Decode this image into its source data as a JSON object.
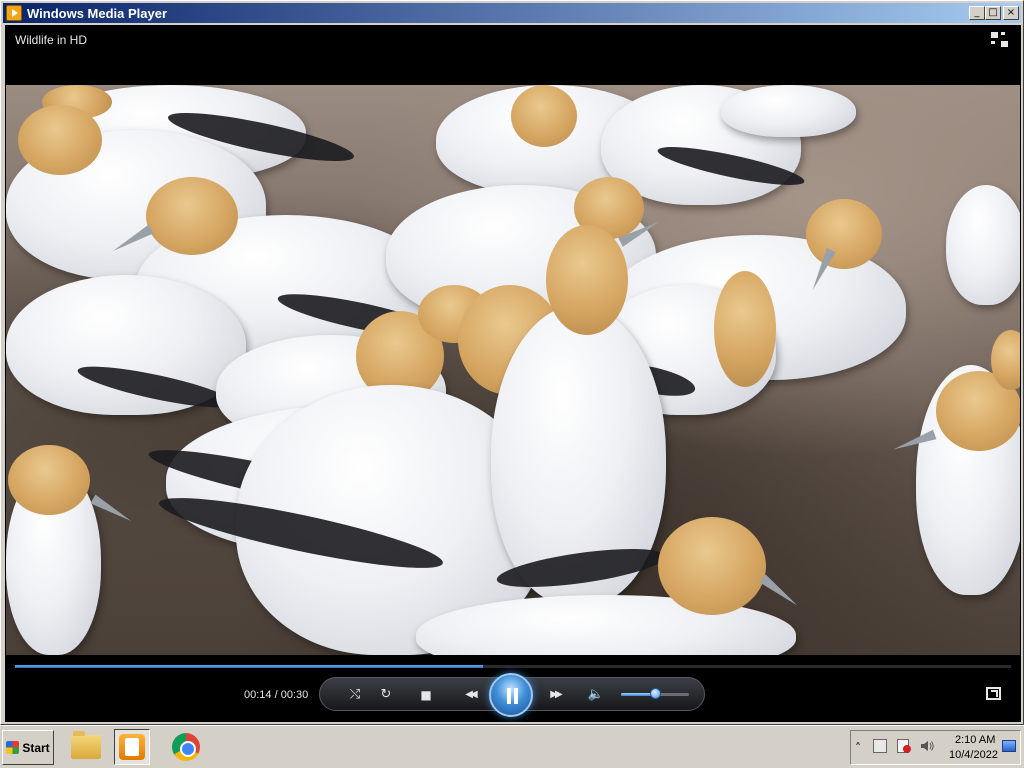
{
  "window": {
    "title": "Windows Media Player",
    "controls": {
      "minimize": "_",
      "maximize": "□",
      "close": "×"
    }
  },
  "player": {
    "media_title": "Wildlife in HD",
    "time_display": "00:14 / 00:30",
    "progress_fraction": 0.47,
    "volume_fraction": 0.5,
    "icons": {
      "shuffle": "⤭",
      "repeat": "↻",
      "stop": "■",
      "previous": "◀◀",
      "next": "▶▶",
      "volume": "🔈"
    },
    "accent_color": "#3f8fd8"
  },
  "taskbar": {
    "start_label": "Start",
    "apps": [
      "file-explorer",
      "windows-media-player",
      "google-chrome"
    ],
    "tray": {
      "expand": "˄",
      "time": "2:10 AM",
      "date": "10/4/2022"
    }
  }
}
